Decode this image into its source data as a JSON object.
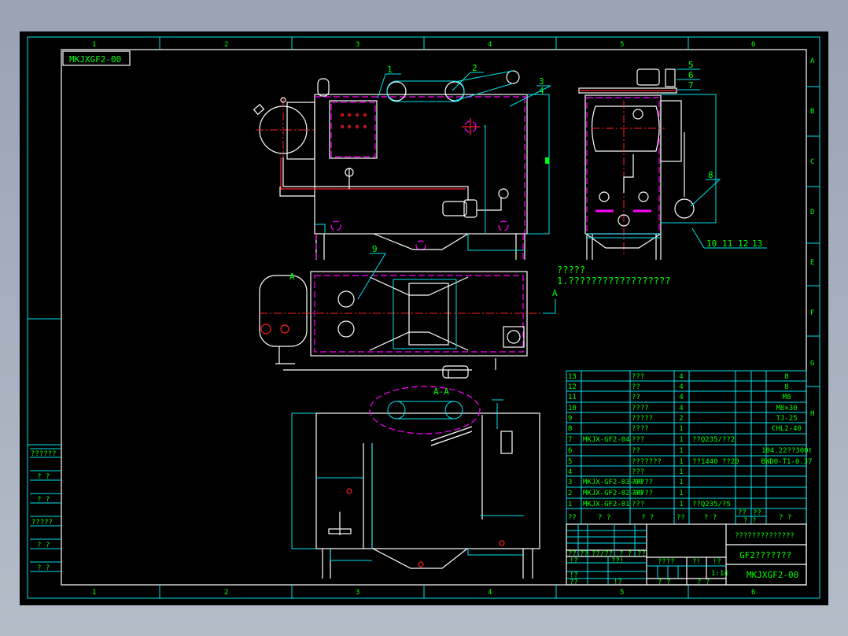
{
  "drawing_number": "MKJXGF2-00",
  "border": {
    "columns": [
      "1",
      "2",
      "3",
      "4",
      "5",
      "6"
    ],
    "rows": [
      "A",
      "B",
      "C",
      "D",
      "E",
      "F",
      "G",
      "H"
    ]
  },
  "views": {
    "section_label": "A-A",
    "section_marker": "A",
    "balloons": [
      "1",
      "2",
      "3",
      "4",
      "5",
      "6",
      "7",
      "8",
      "9",
      "10",
      "11",
      "12",
      "13"
    ]
  },
  "notes": {
    "heading": "?????",
    "line1": "1.??????????????????"
  },
  "parts_list": {
    "rows": [
      {
        "no": "13",
        "code": "",
        "name": "???",
        "qty": "4",
        "material": "",
        "spec": "8"
      },
      {
        "no": "12",
        "code": "",
        "name": "??",
        "qty": "4",
        "material": "",
        "spec": "8"
      },
      {
        "no": "11",
        "code": "",
        "name": "??",
        "qty": "4",
        "material": "",
        "spec": "M8"
      },
      {
        "no": "10",
        "code": "",
        "name": "????",
        "qty": "4",
        "material": "",
        "spec": "M8×30"
      },
      {
        "no": "9",
        "code": "",
        "name": "?????",
        "qty": "2",
        "material": "",
        "spec": "TJ-25"
      },
      {
        "no": "8",
        "code": "",
        "name": "????",
        "qty": "1",
        "material": "",
        "spec": "CHL2-40"
      },
      {
        "no": "7",
        "code": "MKJX-GF2-04",
        "name": "???",
        "qty": "1",
        "material": "??Q235/??2",
        "spec": ""
      },
      {
        "no": "6",
        "code": "",
        "name": "??",
        "qty": "1",
        "material": "",
        "spec": "104.22??300ℓ"
      },
      {
        "no": "5",
        "code": "",
        "name": "???????",
        "qty": "1",
        "material": "??1440 ??20",
        "spec": "BWD0-T1-0.37"
      },
      {
        "no": "4",
        "code": "",
        "name": "???",
        "qty": "1",
        "material": "",
        "spec": ""
      },
      {
        "no": "3",
        "code": "MKJX-GF2-03-00",
        "name": "?????",
        "qty": "1",
        "material": "",
        "spec": ""
      },
      {
        "no": "2",
        "code": "MKJX-GF2-02-00",
        "name": "?????",
        "qty": "1",
        "material": "",
        "spec": ""
      },
      {
        "no": "1",
        "code": "MKJX-GF2-01",
        "name": "???",
        "qty": "1",
        "material": "??Q235/?5",
        "spec": ""
      }
    ],
    "header": {
      "no": "??",
      "code": "? ?",
      "name": "? ?",
      "qty": "??",
      "material": "? ?",
      "single": "??",
      "total": "??",
      "weight": "? ?",
      "spec": "? ?"
    }
  },
  "title_block": {
    "company": "??????????????",
    "product_name": "GF2???????",
    "drawing_number": "MKJXGF2-00",
    "scale": "1:14",
    "labels": [
      "??",
      "??",
      "??/??",
      "? ?",
      "??",
      "!?",
      "??!",
      "!?",
      "??",
      "!?",
      "????",
      "?!",
      "!?",
      "? ?",
      "? ?"
    ]
  },
  "side_strip": [
    "??????",
    "? ?",
    "? ?",
    "?????",
    "? ?",
    "? ?"
  ],
  "colors": {
    "sheet": "#000000",
    "frame": "#00e5ee",
    "outline": "#ffffff",
    "centerline": "#ff2020",
    "hidden": "#ff00ff",
    "text": "#00ff00"
  }
}
